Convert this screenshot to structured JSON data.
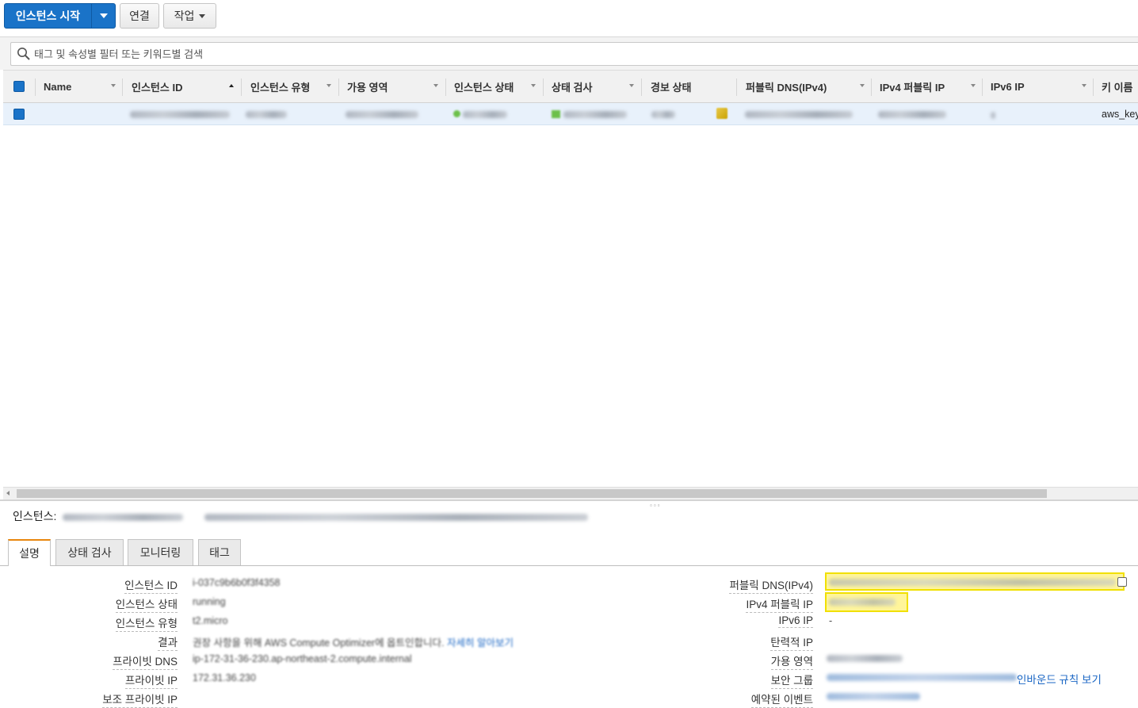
{
  "toolbar": {
    "launch_label": "인스턴스 시작",
    "connect_label": "연결",
    "actions_label": "작업"
  },
  "search": {
    "placeholder": "태그 및 속성별 필터 또는 키워드별 검색"
  },
  "grid": {
    "columns": [
      "Name",
      "인스턴스 ID",
      "인스턴스 유형",
      "가용 영역",
      "인스턴스 상태",
      "상태 검사",
      "경보 상태",
      "퍼블릭 DNS(IPv4)",
      "IPv4 퍼블릭 IP",
      "IPv6 IP",
      "키 이름"
    ],
    "row": {
      "key_name": "aws_key"
    },
    "colors": {
      "header_bg": "#f1f1f1",
      "selected_row_bg": "#e8f1fb"
    }
  },
  "detail": {
    "title_label": "인스턴스:",
    "tabs": [
      "설명",
      "상태 검사",
      "모니터링",
      "태그"
    ],
    "left_labels": [
      "인스턴스 ID",
      "인스턴스 상태",
      "인스턴스 유형",
      "결과",
      "프라이빗 DNS",
      "프라이빗 IP",
      "보조 프라이빗 IP"
    ],
    "left_values": {
      "instance_id": "i-037c9b6b0f3f4358",
      "state": "running",
      "type": "t2.micro",
      "finding": "권장 사항을 위해 AWS Compute Optimizer에 옵트인합니다.",
      "finding_link": "자세히 알아보기",
      "private_dns": "ip-172-31-36-230.ap-northeast-2.compute.internal",
      "private_ip": "172.31.36.230"
    },
    "right_labels": [
      "퍼블릭 DNS(IPv4)",
      "IPv4 퍼블릭 IP",
      "IPv6 IP",
      "탄력적 IP",
      "가용 영역",
      "보안 그룹",
      "예약된 이벤트"
    ],
    "ipv6_value": "-",
    "inbound_rules_link": "인바운드 규칙 보기",
    "highlight_color": "#fff59a",
    "accent": "#1a73c8"
  }
}
